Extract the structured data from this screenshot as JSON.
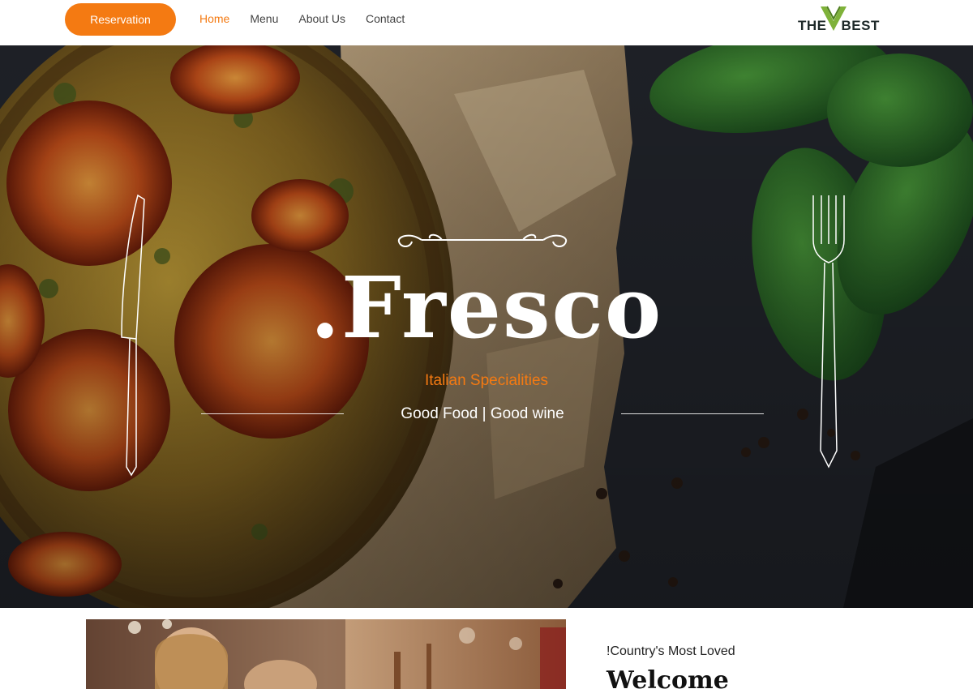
{
  "header": {
    "reservation_label": "Reservation",
    "nav": [
      {
        "label": "Home",
        "active": true
      },
      {
        "label": "Menu",
        "active": false
      },
      {
        "label": "About Us",
        "active": false
      },
      {
        "label": "Contact",
        "active": false
      }
    ],
    "logo": {
      "text_left": "THE",
      "text_right": "BEST"
    }
  },
  "hero": {
    "title": ".Fresco",
    "subtitle": "Italian Specialities",
    "tagline": "Good Food | Good wine"
  },
  "about": {
    "eyebrow": "!Country's Most Loved",
    "heading": "Welcome"
  },
  "colors": {
    "accent": "#f47a12",
    "dark": "#1f2a2a"
  },
  "icons": [
    "knife-icon",
    "fork-icon",
    "ornament-flourish"
  ]
}
